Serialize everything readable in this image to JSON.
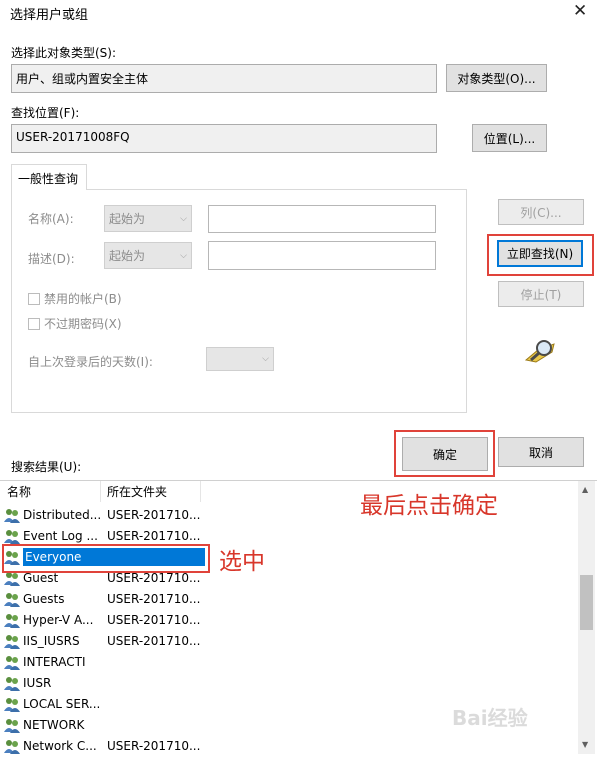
{
  "window": {
    "title": "选择用户或组",
    "close_glyph": "✕"
  },
  "object_type": {
    "label": "选择此对象类型(S):",
    "value": "用户、组或内置安全主体",
    "button": "对象类型(O)..."
  },
  "location": {
    "label": "查找位置(F):",
    "value": "USER-20171008FQ",
    "button": "位置(L)..."
  },
  "tab": {
    "label": "一般性查询"
  },
  "query": {
    "name_label": "名称(A):",
    "name_mode": "起始为",
    "desc_label": "描述(D):",
    "desc_mode": "起始为",
    "disabled_accounts": "禁用的帐户(B)",
    "no_expire": "不过期密码(X)",
    "days_label": "自上次登录后的天数(I):"
  },
  "buttons": {
    "columns": "列(C)...",
    "find_now": "立即查找(N)",
    "stop": "停止(T)",
    "ok": "确定",
    "cancel": "取消"
  },
  "results": {
    "label": "搜索结果(U):",
    "columns": [
      "名称",
      "所在文件夹"
    ],
    "rows": [
      {
        "name": "Distributed...",
        "folder": "USER-201710..."
      },
      {
        "name": "Event Log ...",
        "folder": "USER-201710..."
      },
      {
        "name": "Everyone",
        "folder": ""
      },
      {
        "name": "Guest",
        "folder": "USER-201710..."
      },
      {
        "name": "Guests",
        "folder": "USER-201710..."
      },
      {
        "name": "Hyper-V A...",
        "folder": "USER-201710..."
      },
      {
        "name": "IIS_IUSRS",
        "folder": "USER-201710..."
      },
      {
        "name": "INTERACTI",
        "folder": ""
      },
      {
        "name": "IUSR",
        "folder": ""
      },
      {
        "name": "LOCAL SER...",
        "folder": ""
      },
      {
        "name": "NETWORK",
        "folder": ""
      },
      {
        "name": "Network C...",
        "folder": "USER-201710..."
      }
    ]
  },
  "annotations": {
    "final_click": "最后点击确定",
    "select": "选中"
  },
  "watermark": "Bai经验",
  "colors": {
    "highlight": "#0078d7",
    "annotation_red": "#e0433a"
  }
}
